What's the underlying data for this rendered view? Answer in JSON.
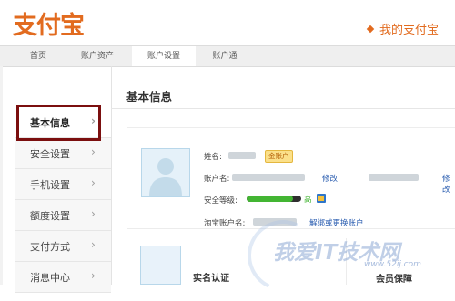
{
  "header": {
    "logo": "支付宝",
    "my_alipay": "我的支付宝"
  },
  "nav": [
    {
      "label": "首页",
      "active": false
    },
    {
      "label": "账户资产",
      "active": false
    },
    {
      "label": "账户设置",
      "active": true
    },
    {
      "label": "账户通",
      "active": false
    }
  ],
  "sidebar": [
    {
      "label": "基本信息",
      "active": true
    },
    {
      "label": "安全设置",
      "active": false
    },
    {
      "label": "手机设置",
      "active": false
    },
    {
      "label": "额度设置",
      "active": false
    },
    {
      "label": "支付方式",
      "active": false
    },
    {
      "label": "消息中心",
      "active": false
    }
  ],
  "main": {
    "title": "基本信息",
    "name_label": "姓名:",
    "badge": "金账户",
    "account_label": "账户名:",
    "edit": "修改",
    "edit_right": "修改",
    "security_label": "安全等级:",
    "security_level_text": "高",
    "security_level_percent": 85,
    "taobao_label": "淘宝账户名:",
    "unbind": "解绑或更换账户",
    "bottom_left_title": "实名认证",
    "bottom_right_title": "会员保障"
  },
  "watermark": {
    "text": "我爱IT技术网",
    "url": "www.52ij.com"
  },
  "colors": {
    "brand_orange": "#e26b1f",
    "link_blue": "#2a5db0",
    "security_green": "#43b533",
    "active_frame": "#7b0f0f"
  }
}
